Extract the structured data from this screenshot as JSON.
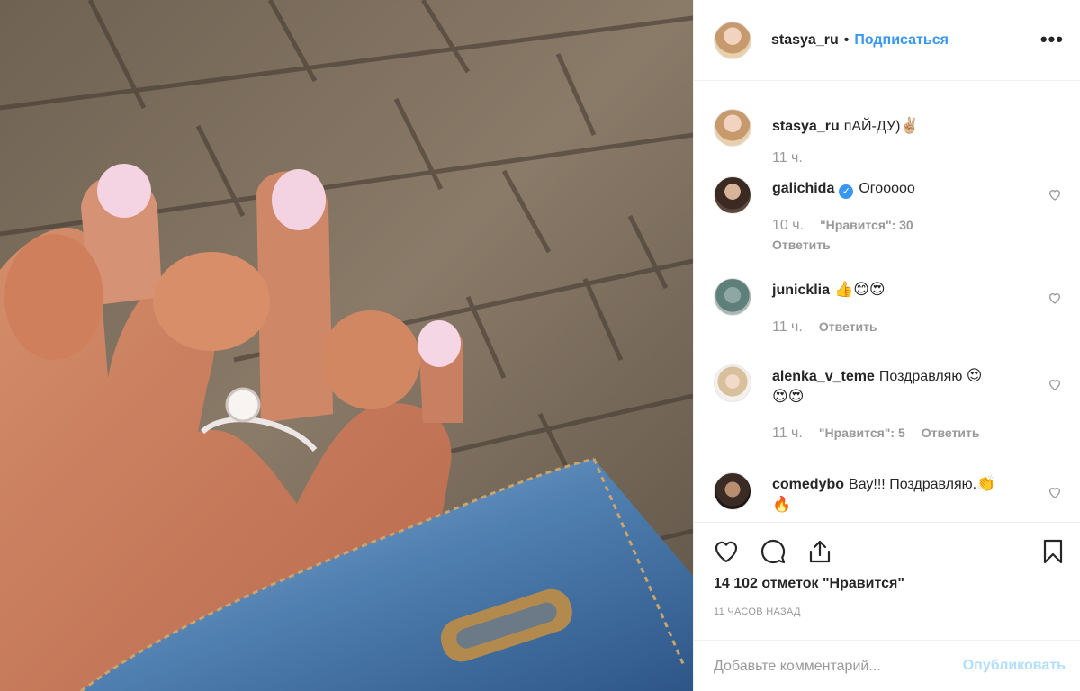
{
  "post": {
    "author": "stasya_ru",
    "separator": "•",
    "follow_label": "Подписаться",
    "more_label": "•••",
    "caption_user": "stasya_ru",
    "caption_text": "пАЙ-ДУ)",
    "caption_emoji": "✌🏼",
    "caption_time": "11 ч."
  },
  "comments": [
    {
      "user": "galichida",
      "verified": true,
      "text": "Огооооо",
      "time": "10 ч.",
      "likes": "\"Нравится\": 30",
      "reply": "Ответить",
      "emoji": ""
    },
    {
      "user": "junicklia",
      "verified": false,
      "text": "",
      "emoji": "👍😊😍",
      "time": "11 ч.",
      "likes": "",
      "reply": "Ответить"
    },
    {
      "user": "alenka_v_teme",
      "verified": false,
      "text": "Поздравляю",
      "emoji": "😍",
      "emoji2": "😍😍",
      "time": "11 ч.",
      "likes": "\"Нравится\": 5",
      "reply": "Ответить"
    },
    {
      "user": "comedybo",
      "verified": false,
      "text": "Вау!!! Поздравляю.",
      "emoji": "👏",
      "emoji2": "🔥",
      "time": "",
      "likes": "",
      "reply": ""
    }
  ],
  "actions": {
    "like_icon": "heart-icon",
    "comment_icon": "comment-icon",
    "share_icon": "share-icon",
    "save_icon": "bookmark-icon"
  },
  "likes_total": "14 102 отметок \"Нравится\"",
  "posted_ago": "11 ЧАСОВ НАЗАД",
  "comment_input": {
    "placeholder": "Добавьте комментарий..."
  },
  "publish_label": "Опубликовать",
  "colors": {
    "accent": "#3897f0",
    "publish_disabled": "#b2dffc",
    "muted": "#999999"
  }
}
